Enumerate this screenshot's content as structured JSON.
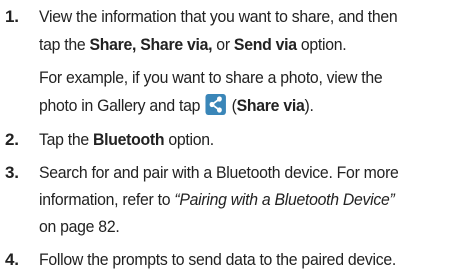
{
  "steps": [
    {
      "number": "1.",
      "lines": [
        {
          "parts": [
            {
              "t": "View the information that you want to share, and then",
              "s": ""
            }
          ]
        },
        {
          "parts": [
            {
              "t": "tap the ",
              "s": ""
            },
            {
              "t": "Share, Share via,",
              "s": "b"
            },
            {
              "t": " or ",
              "s": ""
            },
            {
              "t": "Send via",
              "s": "b"
            },
            {
              "t": " option.",
              "s": ""
            }
          ]
        },
        {
          "parts": [
            {
              "t": "For example, if you want to share a photo, view the",
              "s": ""
            }
          ]
        },
        {
          "parts": [
            {
              "t": "photo in Gallery and tap ",
              "s": ""
            },
            {
              "icon": "share-icon"
            },
            {
              "t": " (",
              "s": ""
            },
            {
              "t": "Share via",
              "s": "b"
            },
            {
              "t": ").",
              "s": ""
            }
          ]
        }
      ]
    },
    {
      "number": "2.",
      "lines": [
        {
          "parts": [
            {
              "t": "Tap the ",
              "s": ""
            },
            {
              "t": "Bluetooth",
              "s": "b"
            },
            {
              "t": " option.",
              "s": ""
            }
          ]
        }
      ]
    },
    {
      "number": "3.",
      "lines": [
        {
          "parts": [
            {
              "t": "Search for and pair with a Bluetooth device. For more",
              "s": ""
            }
          ]
        },
        {
          "parts": [
            {
              "t": "information, refer to ",
              "s": ""
            },
            {
              "t": "“Pairing with a Bluetooth Device”",
              "s": "i"
            }
          ]
        },
        {
          "parts": [
            {
              "t": "on page 82.",
              "s": ""
            }
          ]
        }
      ]
    },
    {
      "number": "4.",
      "lines": [
        {
          "parts": [
            {
              "t": "Follow the prompts to send data to the paired device.",
              "s": ""
            }
          ]
        }
      ]
    }
  ],
  "colors": {
    "text": "#222222",
    "icon_bg": "#3a86b8",
    "icon_fg": "#ffffff"
  }
}
